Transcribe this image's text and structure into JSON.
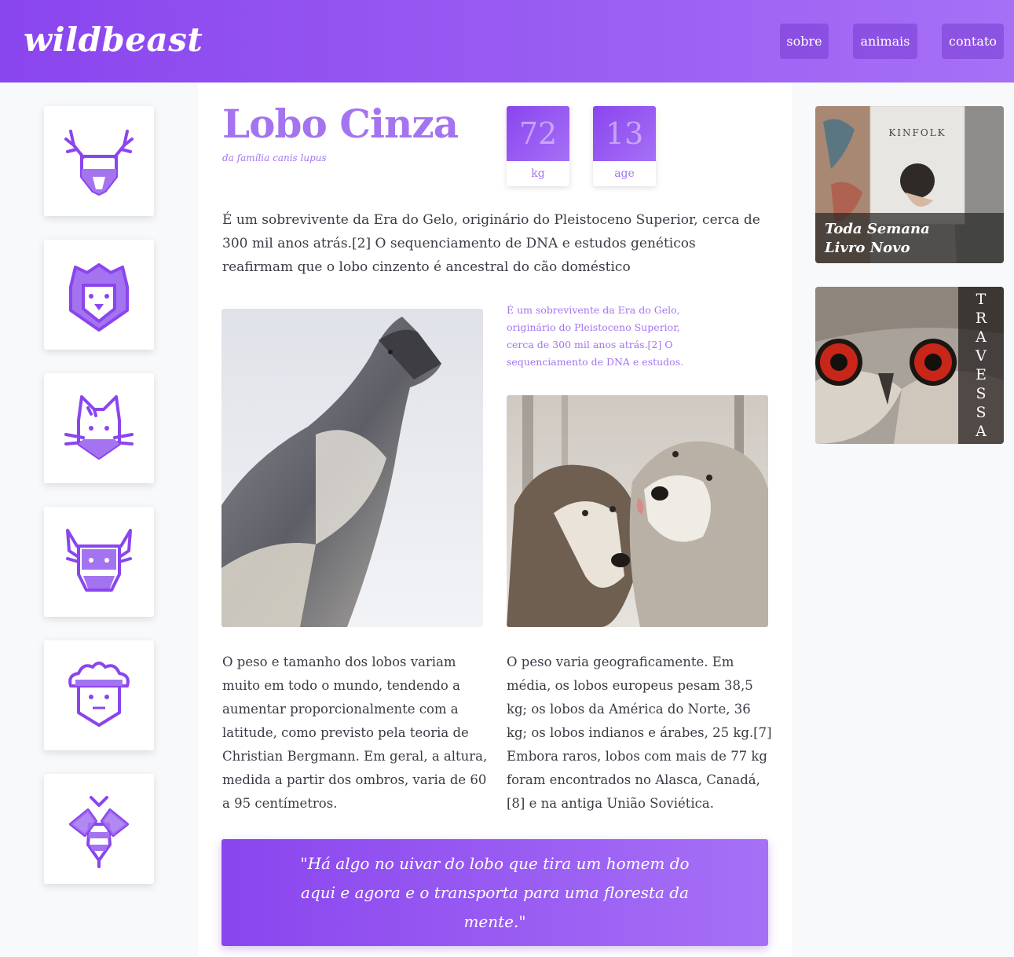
{
  "header": {
    "logo": "wildbeast",
    "nav": {
      "sobre": "sobre",
      "animais": "animais",
      "contato": "contato"
    }
  },
  "sidebar": {
    "icons": [
      "deer-icon",
      "lion-icon",
      "cat-icon",
      "bull-icon",
      "sheep-icon",
      "bee-icon"
    ]
  },
  "article": {
    "title": "Lobo Cinza",
    "subtitle": "da família canis lupus",
    "stats": {
      "weight": {
        "value": "72",
        "label": "kg"
      },
      "age": {
        "value": "13",
        "label": "age"
      }
    },
    "intro": "É um sobrevivente da Era do Gelo, originário do Pleistoceno Superior, cerca de 300 mil anos atrás.[2] O sequenciamento de DNA e estudos genéticos reafirmam que o lobo cinzento é ancestral do cão doméstico",
    "caption": "É um sobrevivente da Era do Gelo, originário do Pleistoceno Superior, cerca de 300 mil anos atrás.[2] O sequenciamento de DNA e estudos.",
    "body_left": "O peso e tamanho dos lobos variam muito em todo o mundo, tendendo a aumentar proporcionalmente com a latitude, como previsto pela teoria de Christian Bergmann. Em geral, a altura, medida a partir dos ombros, varia de 60 a 95 centímetros.",
    "body_right": "O peso varia geograficamente. Em média, os lobos europeus pesam 38,5 kg; os lobos da América do Norte, 36 kg; os lobos indianos e árabes, 25 kg.[7] Embora raros, lobos com mais de 77 kg foram encontrados no Alasca, Canadá,[8] e na antiga União Soviética.",
    "quote": "\"Há algo no uivar do lobo que tira um homem do aqui e agora e o transporta para uma floresta da mente.\""
  },
  "ads": {
    "kinfolk": {
      "brand": "KINFOLK",
      "line1": "Toda Semana",
      "line2": "Livro Novo"
    },
    "travessa": {
      "letters": [
        "T",
        "R",
        "A",
        "V",
        "E",
        "S",
        "S",
        "A"
      ]
    }
  },
  "colors": {
    "accent": "#a474f0",
    "header_start": "#8a45ee",
    "header_end": "#a670f6"
  }
}
